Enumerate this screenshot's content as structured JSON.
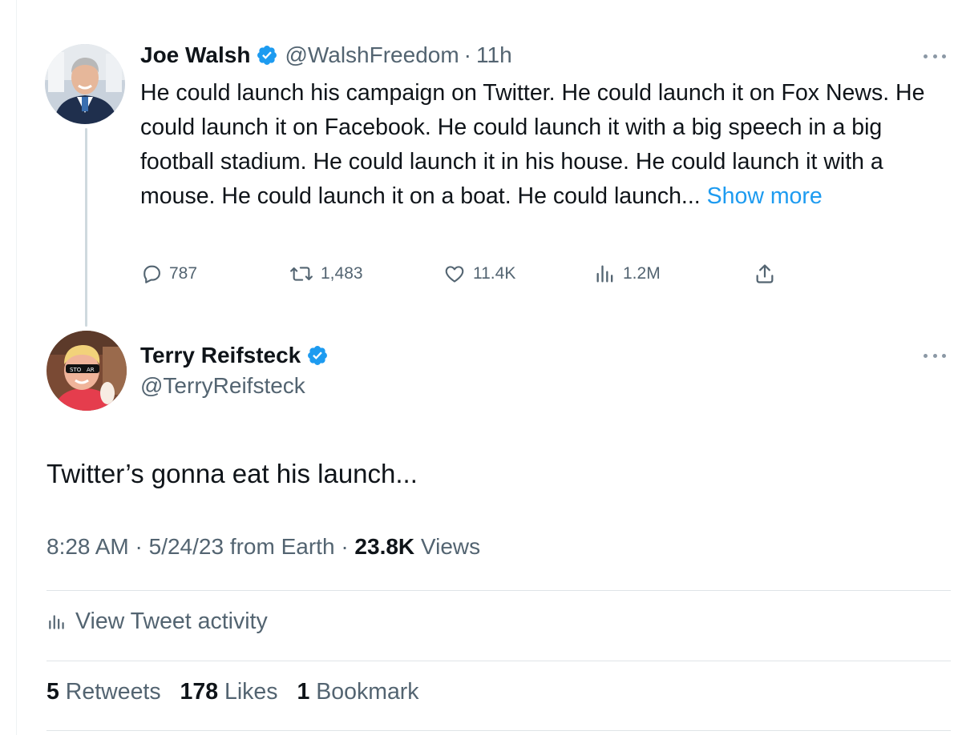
{
  "parent_tweet": {
    "author_name": "Joe Walsh",
    "handle": "@WalshFreedom",
    "separator": "·",
    "time": "11h",
    "text": "He could launch his campaign on Twitter. He could launch it on Fox News. He could launch it on Facebook. He could launch it with a big speech in a big football stadium. He could launch it in his house. He could launch it with a mouse. He could launch it on a boat. He could launch...",
    "show_more": "Show more",
    "actions": {
      "replies": "787",
      "retweets": "1,483",
      "likes": "11.4K",
      "views": "1.2M"
    },
    "icons": {
      "verified": "verified-badge-icon",
      "more": "more-options-icon",
      "reply": "reply-icon",
      "retweet": "retweet-icon",
      "like": "heart-icon",
      "views": "views-chart-icon",
      "share": "share-icon"
    }
  },
  "main_tweet": {
    "author_name": "Terry Reifsteck",
    "handle": "@TerryReifsteck",
    "text": "Twitter’s gonna eat his launch...",
    "time": "8:28 AM",
    "separator": "·",
    "date": "5/24/23 from Earth",
    "views_count": "23.8K",
    "views_label": "Views",
    "activity_label": "View Tweet activity",
    "stats": {
      "retweets_count": "5",
      "retweets_label": "Retweets",
      "likes_count": "178",
      "likes_label": "Likes",
      "bookmarks_count": "1",
      "bookmarks_label": "Bookmark"
    }
  },
  "colors": {
    "text_primary": "#0f1419",
    "text_secondary": "#536471",
    "link": "#1d9bf0",
    "verified": "#1d9bf0",
    "thread_line": "#cfd9de"
  }
}
